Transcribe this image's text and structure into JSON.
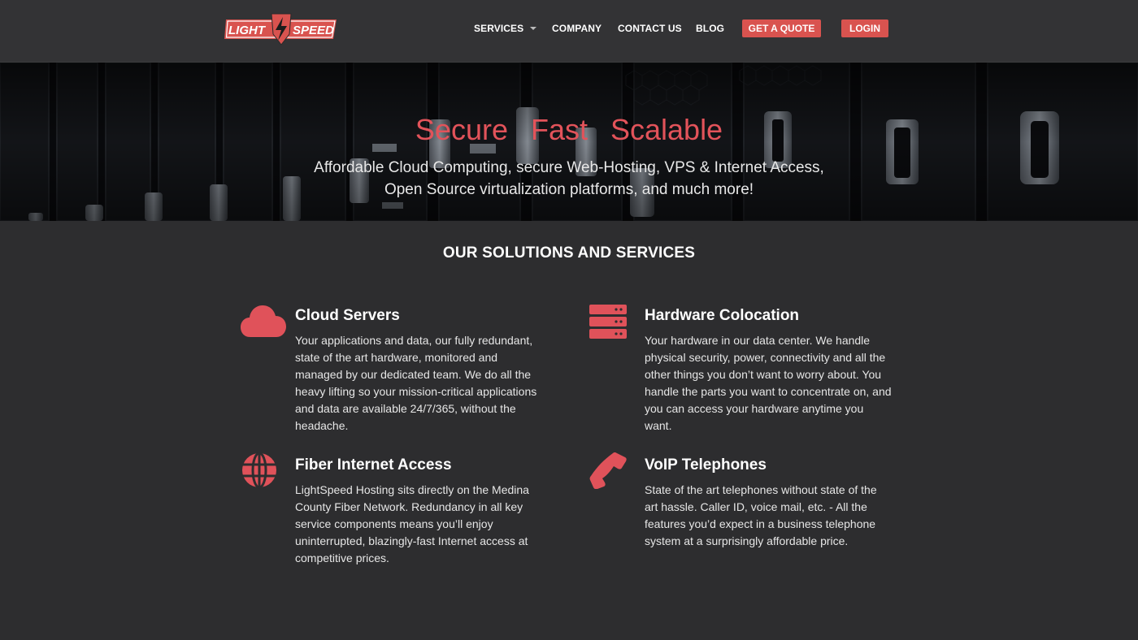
{
  "brand": {
    "logo_text_left": "LIGHT",
    "logo_text_right": "SPEED",
    "accent_color": "#d9534f"
  },
  "nav": {
    "services": "SERVICES",
    "company": "COMPANY",
    "contact": "CONTACT US",
    "blog": "BLOG",
    "quote_button": "GET A QUOTE",
    "login_button": "LOGIN"
  },
  "hero": {
    "tagline": "Secure  Fast  Scalable",
    "subtitle_line1": "Affordable Cloud Computing, secure Web-Hosting, VPS & Internet Access,",
    "subtitle_line2": "Open Source virtualization platforms, and much more!"
  },
  "solutions": {
    "title": "OUR SOLUTIONS AND SERVICES",
    "items": [
      {
        "icon": "cloud-icon",
        "title": "Cloud Servers",
        "description": "Your applications and data, our fully redundant, state of the art hardware, monitored and managed by our dedicated team. We do all the heavy lifting so your mission-critical applications and data are available 24/7/365, without the headache."
      },
      {
        "icon": "server-rack-icon",
        "title": "Hardware Colocation",
        "description": "Your hardware in our data center. We handle physical security, power, connectivity and all the other things you don’t want to worry about. You handle the parts you want to concentrate on, and you can access your hardware anytime you want."
      },
      {
        "icon": "globe-icon",
        "title": "Fiber Internet Access",
        "description": "LightSpeed Hosting sits directly on the Medina County Fiber Network. Redundancy in all key service components means you’ll enjoy uninterrupted, blazingly-fast Internet access at competitive prices."
      },
      {
        "icon": "phone-icon",
        "title": "VoIP Telephones",
        "description": "State of the art telephones without state of the art hassle. Caller ID, voice mail, etc. - All the features you’d expect in a business telephone system at a surprisingly affordable price."
      }
    ]
  }
}
